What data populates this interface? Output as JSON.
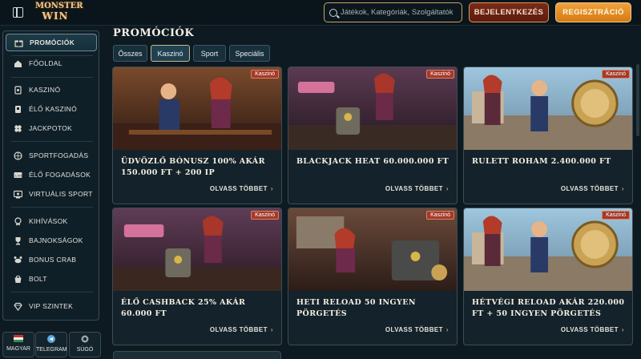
{
  "header": {
    "logo_line1": "MONSTER",
    "logo_line2": "WIN",
    "search_placeholder": "Játékok, Kategóriák, Szolgáltatók",
    "login_label": "BEJELENTKEZÉS",
    "register_label": "REGISZTRÁCIÓ"
  },
  "sidebar": {
    "items": [
      {
        "label": "PROMÓCIÓK",
        "icon": "gift-icon"
      },
      {
        "label": "FŐOLDAL",
        "icon": "home-icon"
      },
      {
        "label": "KASZINÓ",
        "icon": "cards-icon"
      },
      {
        "label": "ÉLŐ KASZINÓ",
        "icon": "live-casino-icon"
      },
      {
        "label": "JACKPOTOK",
        "icon": "clover-icon"
      },
      {
        "label": "SPORTFOGADÁS",
        "icon": "ball-icon"
      },
      {
        "label": "ÉLŐ FOGADÁSOK",
        "icon": "live-tv-icon"
      },
      {
        "label": "VIRTUÁLIS SPORT",
        "icon": "virtual-sport-icon"
      },
      {
        "label": "KIHÍVÁSOK",
        "icon": "medal-icon"
      },
      {
        "label": "BAJNOKSÁGOK",
        "icon": "trophy-icon"
      },
      {
        "label": "BONUS CRAB",
        "icon": "crab-icon"
      },
      {
        "label": "BOLT",
        "icon": "shop-icon"
      },
      {
        "label": "VIP SZINTEK",
        "icon": "diamond-icon"
      }
    ],
    "bottom": [
      {
        "label": "MAGYAR",
        "icon": "flag-hu-icon"
      },
      {
        "label": "TELEGRAM",
        "icon": "telegram-icon"
      },
      {
        "label": "SÚGÓ",
        "icon": "help-icon"
      }
    ]
  },
  "main": {
    "title": "PROMÓCIÓK",
    "tabs": [
      "Összes",
      "Kaszinó",
      "Sport",
      "Speciális"
    ],
    "active_tab": "Kaszinó",
    "read_more": "OLVASS TÖBBET",
    "cards": [
      {
        "badge": "Kaszinó",
        "title": "Üdvözlő bónusz 100% akár 150.000 Ft + 200 IP",
        "scene": "duo-saloon"
      },
      {
        "badge": "Kaszinó",
        "title": "Blackjack heat 60.000.000 Ft",
        "scene": "casino-robot"
      },
      {
        "badge": "Kaszinó",
        "title": "Rulett roham 2.400.000 Ft",
        "scene": "vici-sun"
      },
      {
        "badge": "Kaszinó",
        "title": "Élő cashback 25% akár 60.000 Ft",
        "scene": "casino-robot"
      },
      {
        "badge": "Kaszinó",
        "title": "Heti reload 50 ingyen pörgetés",
        "scene": "slot-girl"
      },
      {
        "badge": "Kaszinó",
        "title": "Hétvégi reload akár 220.000 Ft + 50 ingyen pörgetés",
        "scene": "vici-sun"
      }
    ]
  },
  "colors": {
    "background": "#0d1a22",
    "accent_gold": "#c9a36a",
    "register_orange": "#e58e22",
    "login_red": "#6a2212",
    "badge_red": "#a33a2a"
  }
}
